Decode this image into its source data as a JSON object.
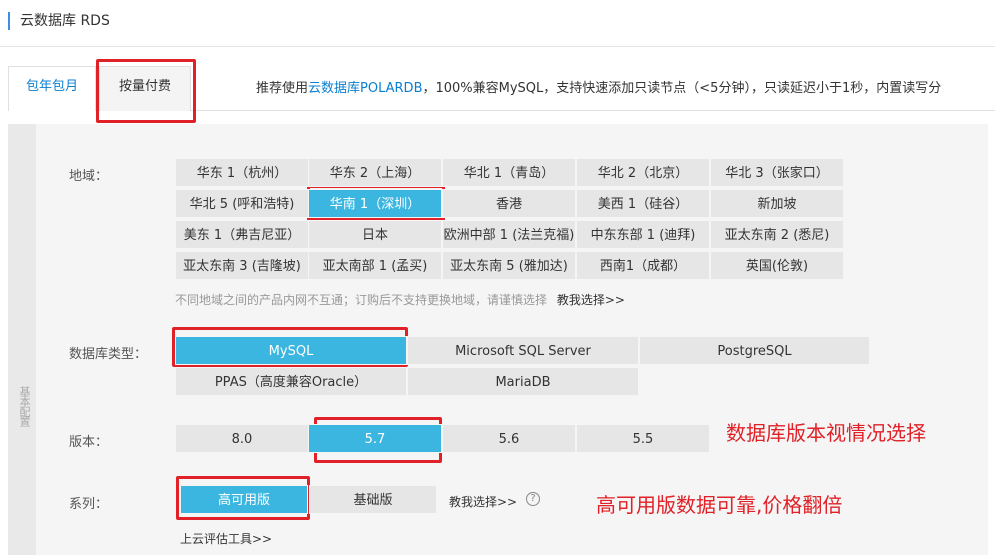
{
  "page": {
    "title": "云数据库 RDS"
  },
  "tabs": [
    {
      "label": "包年包月"
    },
    {
      "label": "按量付费"
    }
  ],
  "promo": {
    "prefix": "推荐使用",
    "link": "云数据库POLARDB",
    "suffix": "，100%兼容MySQL，支持快速添加只读节点（<5分钟），只读延迟小于1秒，内置读写分"
  },
  "sidebar": {
    "label": "基本配置"
  },
  "region": {
    "label": "地域：",
    "rows": [
      [
        "华东 1（杭州）",
        "华东 2（上海）",
        "华北 1（青岛）",
        "华北 2（北京）",
        "华北 3（张家口）"
      ],
      [
        "华北 5 (呼和浩特)",
        "华南 1（深圳）",
        "香港",
        "美西 1（硅谷）",
        "新加坡"
      ],
      [
        "美东 1（弗吉尼亚）",
        "日本",
        "欧洲中部 1 (法兰克福)",
        "中东东部 1 (迪拜)",
        "亚太东南 2 (悉尼)"
      ],
      [
        "亚太东南 3 (吉隆坡)",
        "亚太南部 1 (孟买)",
        "亚太东南 5 (雅加达)",
        "西南1（成都）",
        "英国(伦敦)"
      ]
    ],
    "selected": "华南 1（深圳）",
    "hint": "不同地域之间的产品内网不互通；订购后不支持更换地域，请谨慎选择",
    "hint_link": "教我选择>>"
  },
  "db_type": {
    "label": "数据库类型：",
    "options": [
      "MySQL",
      "Microsoft SQL Server",
      "PostgreSQL",
      "PPAS（高度兼容Oracle）",
      "MariaDB"
    ],
    "selected": "MySQL"
  },
  "version": {
    "label": "版本：",
    "options": [
      "8.0",
      "5.7",
      "5.6",
      "5.5"
    ],
    "selected": "5.7",
    "annotation": "数据库版本视情况选择"
  },
  "series": {
    "label": "系列：",
    "options": [
      "高可用版",
      "基础版"
    ],
    "selected": "高可用版",
    "help_link": "教我选择>>",
    "help_icon": "?",
    "annotation": "高可用版数据可靠,价格翻倍"
  },
  "bottom_link": "上云评估工具>>",
  "colors": {
    "accent": "#3ab6e0",
    "highlight": "#e02127",
    "link": "#0a7fd0"
  }
}
